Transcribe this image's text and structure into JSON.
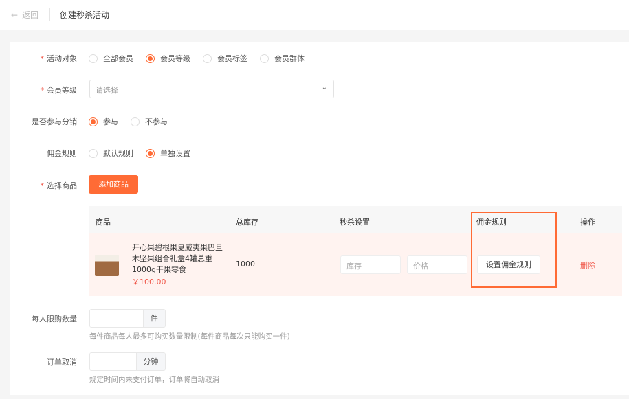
{
  "header": {
    "back_label": "返回",
    "title": "创建秒杀活动"
  },
  "form": {
    "target": {
      "label": "活动对象",
      "options": [
        "全部会员",
        "会员等级",
        "会员标签",
        "会员群体"
      ],
      "selected": "会员等级"
    },
    "level": {
      "label": "会员等级",
      "placeholder": "请选择"
    },
    "distribution": {
      "label": "是否参与分销",
      "options": [
        "参与",
        "不参与"
      ],
      "selected": "参与"
    },
    "commission": {
      "label": "佣金规则",
      "options": [
        "默认规则",
        "单独设置"
      ],
      "selected": "单独设置"
    },
    "goods": {
      "label": "选择商品",
      "add_button": "添加商品"
    },
    "limit": {
      "label": "每人限购数量",
      "unit": "件",
      "hint": "每件商品每人最多可购买数量限制(每件商品每次只能购买一件)"
    },
    "cancel": {
      "label": "订单取消",
      "unit": "分钟",
      "hint": "规定时间内未支付订单，订单将自动取消"
    }
  },
  "table": {
    "headers": [
      "商品",
      "总库存",
      "秒杀设置",
      "佣金规则",
      "操作"
    ],
    "rows": [
      {
        "name": "开心果碧根果夏威夷果巴旦木坚果组合礼盒4罐总重1000g干果零食",
        "price": "￥100.00",
        "stock": "1000",
        "stock_placeholder": "库存",
        "price_placeholder": "价格",
        "commission_button": "设置佣金规则",
        "delete": "删除"
      }
    ]
  },
  "colors": {
    "accent": "#ff6b35",
    "danger": "#f0584a",
    "highlight": "#ff6b35"
  }
}
